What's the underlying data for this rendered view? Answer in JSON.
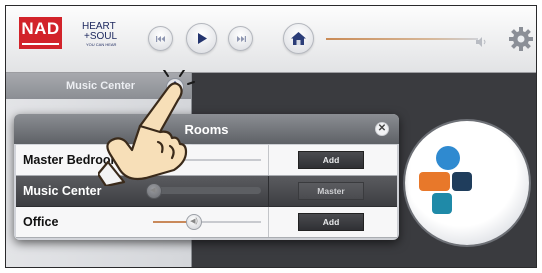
{
  "app": {
    "brand_logo": "NAD",
    "brand_line1": "HEART",
    "brand_line2": "+SOUL",
    "brand_tagline": "YOU CAN HEAR"
  },
  "toolbar": {
    "prev_icon": "skip-previous-icon",
    "play_icon": "play-icon",
    "next_icon": "skip-next-icon",
    "home_icon": "home-icon",
    "volume_icon": "speaker-volume-icon",
    "settings_icon": "gear-icon",
    "volume_fraction": 0.98
  },
  "sidebar": {
    "header": "Music Center",
    "rooms_button_icon": "rooms-icon"
  },
  "rooms_popup": {
    "title": "Rooms",
    "close_icon": "close-icon",
    "rows": [
      {
        "name": "Master Bedroom",
        "action": "Add",
        "volume": 0.15,
        "active": false
      },
      {
        "name": "Music Center",
        "action": "Master",
        "volume": 0.0,
        "active": true
      },
      {
        "name": "Office",
        "action": "Add",
        "volume": 0.32,
        "active": false
      }
    ]
  },
  "main": {
    "service_logo_icon": "tunein-logo-icon"
  },
  "overlay": {
    "pointer_icon": "tapping-hand-icon"
  },
  "colors": {
    "nad_red": "#d2232a",
    "volume_orange": "#c9895a",
    "logo_blue": "#2f8ad0",
    "logo_orange": "#e8782a",
    "logo_navy": "#1f3d5c",
    "logo_teal": "#1f8aa8"
  }
}
